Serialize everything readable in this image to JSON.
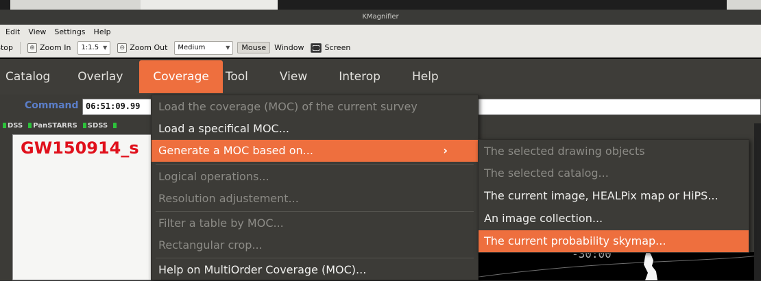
{
  "kmagnifier": {
    "title": "KMagnifier",
    "menu": [
      "Edit",
      "View",
      "Settings",
      "Help"
    ],
    "toolbar": {
      "stop": "Stop",
      "zoom_in": "Zoom In",
      "zoom_value": "1:1.5",
      "zoom_out": "Zoom Out",
      "refresh": "Medium",
      "mode_mouse": "Mouse",
      "mode_window": "Window",
      "mode_screen": "Screen"
    }
  },
  "app": {
    "menubar": [
      "Catalog",
      "Overlay",
      "Coverage",
      "Tool",
      "View",
      "Interop",
      "Help"
    ],
    "active_menu": "Coverage",
    "command_label": "Command",
    "command_value": "06:51:09.99",
    "surveys": [
      "DSS",
      "PanSTARRS",
      "SDSS"
    ],
    "stack_title": "GW150914_s"
  },
  "coverage_menu": {
    "items": [
      {
        "label": "Load the coverage (MOC) of the current survey",
        "enabled": false
      },
      {
        "label": "Load a specifical MOC...",
        "enabled": true
      },
      {
        "label": "Generate a MOC based on...",
        "enabled": true,
        "submenu": true,
        "highlighted": true
      },
      {
        "label": "Logical operations...",
        "enabled": false
      },
      {
        "label": "Resolution adjustement...",
        "enabled": false
      },
      {
        "label": "Filter a table by MOC...",
        "enabled": false
      },
      {
        "label": "Rectangular crop...",
        "enabled": false
      },
      {
        "label": "Help on MultiOrder Coverage (MOC)...",
        "enabled": true
      }
    ]
  },
  "generate_submenu": {
    "items": [
      {
        "label": "The selected drawing objects",
        "enabled": false
      },
      {
        "label": "The selected catalog...",
        "enabled": false
      },
      {
        "label": "The current image, HEALPix map or HiPS...",
        "enabled": true
      },
      {
        "label": "An image collection...",
        "enabled": true
      },
      {
        "label": "The current probability skymap...",
        "enabled": true,
        "highlighted": true
      }
    ]
  },
  "sky": {
    "grid_label": "-30:00"
  },
  "colors": {
    "accent": "#ee6f3e",
    "menu_bg": "#3c3b37",
    "stack_title": "#e0101b",
    "command_label": "#5b7ec8",
    "survey_mark": "#2cc23a"
  }
}
